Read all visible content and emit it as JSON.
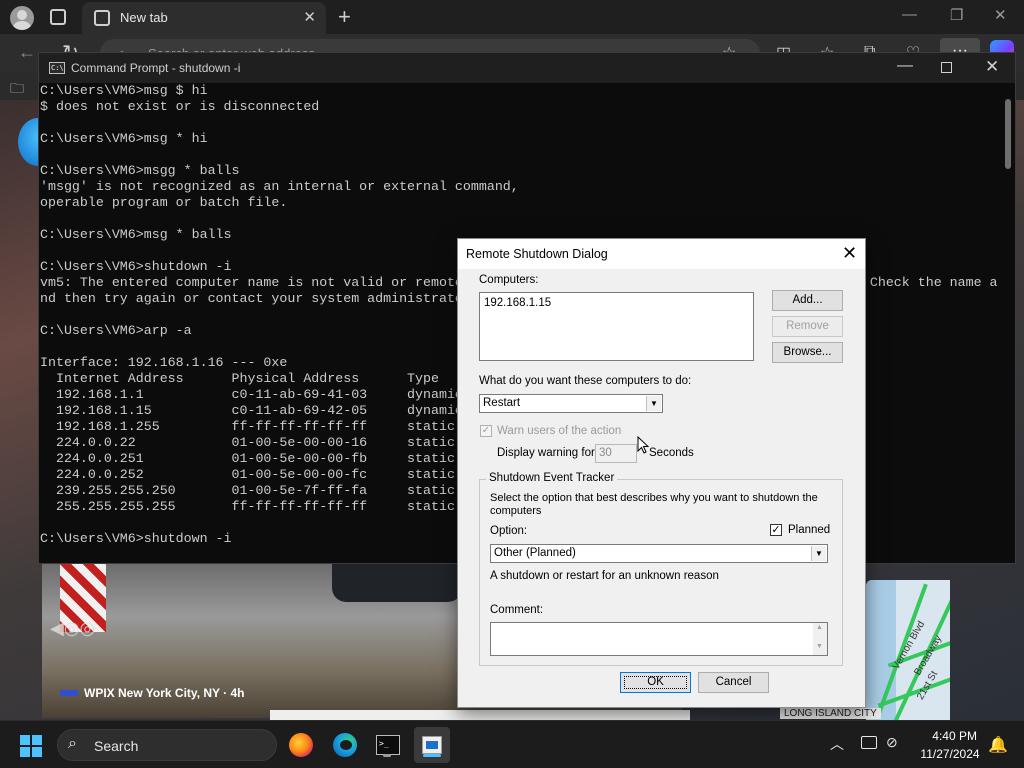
{
  "edge": {
    "tab_title": "New tab",
    "address_placeholder": "Search or enter web address",
    "news_source": "WPIX New York City, NY · 4h",
    "map_labels": [
      "Vernon Blvd",
      "Broadway",
      "21st St"
    ],
    "map_caption": "LONG ISLAND CITY"
  },
  "cmd": {
    "title": "Command Prompt - shutdown  -i",
    "lines": [
      "C:\\Users\\VM6>msg $ hi",
      "$ does not exist or is disconnected",
      "",
      "C:\\Users\\VM6>msg * hi",
      "",
      "C:\\Users\\VM6>msgg * balls",
      "'msgg' is not recognized as an internal or external command,",
      "operable program or batch file.",
      "",
      "C:\\Users\\VM6>msg * balls",
      "",
      "C:\\Users\\VM6>shutdown -i",
      "vm5: The entered computer name is not valid or remote shutdown is not supported on the target computer. Check the name a",
      "nd then try again or contact your system administrator.",
      "",
      "C:\\Users\\VM6>arp -a",
      "",
      "Interface: 192.168.1.16 --- 0xe",
      "  Internet Address      Physical Address      Type",
      "  192.168.1.1           c0-11-ab-69-41-03     dynamic",
      "  192.168.1.15          c0-11-ab-69-42-05     dynamic",
      "  192.168.1.255         ff-ff-ff-ff-ff-ff     static",
      "  224.0.0.22            01-00-5e-00-00-16     static",
      "  224.0.0.251           01-00-5e-00-00-fb     static",
      "  224.0.0.252           01-00-5e-00-00-fc     static",
      "  239.255.255.250       01-00-5e-7f-ff-fa     static",
      "  255.255.255.255       ff-ff-ff-ff-ff-ff     static",
      "",
      "C:\\Users\\VM6>shutdown -i"
    ]
  },
  "dialog": {
    "title": "Remote Shutdown Dialog",
    "computers_label": "Computers:",
    "computers": [
      "192.168.1.15"
    ],
    "add_label": "Add...",
    "remove_label": "Remove",
    "browse_label": "Browse...",
    "action_question": "What do you want these computers to do:",
    "action_value": "Restart",
    "warn_label": "Warn users of the action",
    "warn_checked": true,
    "display_warning_label": "Display warning for",
    "seconds_value": "30",
    "seconds_label": "Seconds",
    "tracker_title": "Shutdown Event Tracker",
    "tracker_desc_1": "Select the option that best describes why you want to shutdown the",
    "tracker_desc_2": "computers",
    "option_label": "Option:",
    "planned_label": "Planned",
    "planned_checked": true,
    "option_value": "Other (Planned)",
    "option_description": "A shutdown or restart for an unknown reason",
    "comment_label": "Comment:",
    "comment_value": "",
    "ok_label": "OK",
    "cancel_label": "Cancel"
  },
  "taskbar": {
    "search_label": "Search",
    "time": "4:40 PM",
    "date": "11/27/2024"
  },
  "colors": {
    "accent": "#4cc2ff",
    "cmd_text": "#cccccc",
    "cmd_bg": "#0c0c0c",
    "dialog_bg": "#f0f0f0"
  }
}
